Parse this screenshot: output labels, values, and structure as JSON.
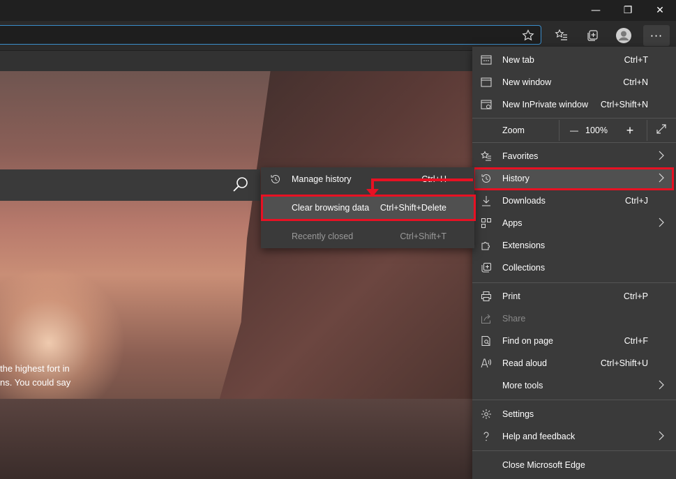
{
  "window": {
    "minimize_glyph": "—",
    "restore_glyph": "❐",
    "close_glyph": "✕"
  },
  "toolbar": {
    "more_glyph": "···",
    "icons": [
      "favorite-star-icon",
      "favorites-list-icon",
      "collections-icon",
      "profile-avatar-icon",
      "more-options-icon"
    ]
  },
  "page": {
    "caption_line1": "the highest fort in",
    "caption_line2": "ns. You could say"
  },
  "menu": {
    "new_tab": {
      "label": "New tab",
      "shortcut": "Ctrl+T"
    },
    "new_window": {
      "label": "New window",
      "shortcut": "Ctrl+N"
    },
    "new_inprivate": {
      "label": "New InPrivate window",
      "shortcut": "Ctrl+Shift+N"
    },
    "zoom": {
      "label": "Zoom",
      "minus": "—",
      "value": "100%",
      "plus": "+"
    },
    "favorites": {
      "label": "Favorites"
    },
    "history": {
      "label": "History"
    },
    "downloads": {
      "label": "Downloads",
      "shortcut": "Ctrl+J"
    },
    "apps": {
      "label": "Apps"
    },
    "extensions": {
      "label": "Extensions"
    },
    "collections": {
      "label": "Collections"
    },
    "print": {
      "label": "Print",
      "shortcut": "Ctrl+P"
    },
    "share": {
      "label": "Share"
    },
    "find": {
      "label": "Find on page",
      "shortcut": "Ctrl+F"
    },
    "read_aloud": {
      "label": "Read aloud",
      "shortcut": "Ctrl+Shift+U"
    },
    "more_tools": {
      "label": "More tools"
    },
    "settings": {
      "label": "Settings"
    },
    "help": {
      "label": "Help and feedback"
    },
    "close_edge": {
      "label": "Close Microsoft Edge"
    }
  },
  "history_submenu": {
    "manage": {
      "label": "Manage history",
      "shortcut": "Ctrl+H"
    },
    "clear": {
      "label": "Clear browsing data",
      "shortcut": "Ctrl+Shift+Delete"
    },
    "recently_closed": {
      "label": "Recently closed",
      "shortcut": "Ctrl+Shift+T"
    }
  },
  "colors": {
    "highlight_border": "#e81123",
    "menu_bg": "#3a3a3a",
    "accent_focus": "#3b8ecc"
  }
}
